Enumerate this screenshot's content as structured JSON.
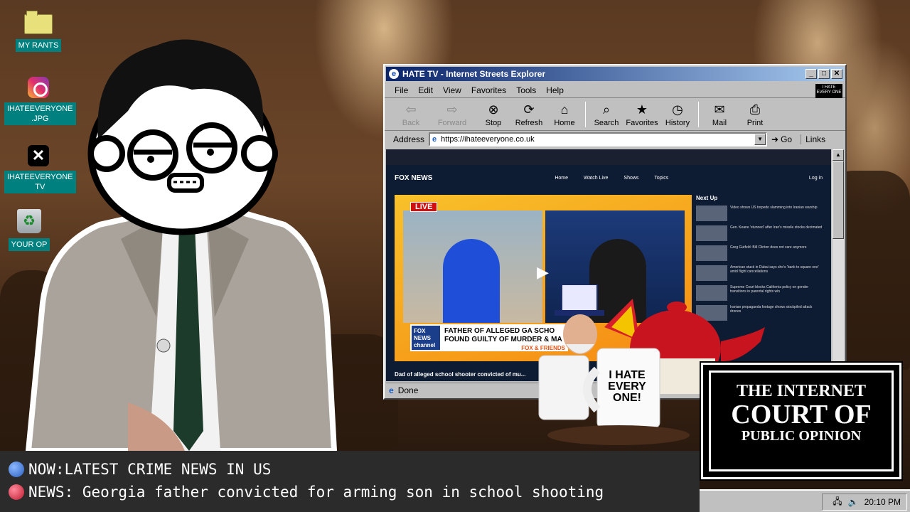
{
  "desktop": {
    "icons": [
      {
        "label": "MY RANTS",
        "icon": "folder-icon"
      },
      {
        "label": "IHATEEVERYONE\n.JPG",
        "icon": "instagram-icon"
      },
      {
        "label": "IHATEEVERYONE\nTV",
        "icon": "x-icon"
      },
      {
        "label": "YOUR OP",
        "icon": "recycle-bin-icon"
      }
    ]
  },
  "browser": {
    "title": "HATE TV - Internet Streets Explorer",
    "menu": [
      "File",
      "Edit",
      "View",
      "Favorites",
      "Tools",
      "Help"
    ],
    "toolbar": {
      "back": "Back",
      "forward": "Forward",
      "stop": "Stop",
      "refresh": "Refresh",
      "home": "Home",
      "search": "Search",
      "favorites": "Favorites",
      "history": "History",
      "mail": "Mail",
      "print": "Print"
    },
    "address_label": "Address",
    "url": "https://ihateeveryone.co.uk",
    "go": "Go",
    "links": "Links",
    "status": "Done",
    "brand_badge": "I HATE EVERY ONE"
  },
  "page": {
    "site_logo": "FOX NEWS",
    "nav": [
      "Home",
      "Watch Live",
      "Shows",
      "Topics"
    ],
    "login": "Log in",
    "live_badge": "LIVE",
    "chyron_logo": "FOX NEWS channel",
    "chyron_line1": "FATHER OF ALLEGED GA SCHO",
    "chyron_line2": "FOUND GUILTY OF MURDER & MA",
    "chyron_show": "FOX & FRIENDS",
    "next_up_label": "Next Up",
    "next_up": [
      "Video shows US torpedo slamming into Iranian warship",
      "Gen. Keane 'stunned' after Iran's missile stocks decimated",
      "Greg Gutfeld: Bill Clinton does not care anymore",
      "American stuck in Dubai says she's 'bank to square one' amid flight cancellations",
      "Supreme Court blocks California policy on gender transitions in parental rights win",
      "Iranian propaganda footage shows stockpiled attack drones"
    ],
    "video_title": "Dad of alleged school shooter convicted of mu..."
  },
  "mug": {
    "text": "I HATE EVERY ONE!"
  },
  "court_sign": {
    "line1": "THE INTERNET",
    "line2": "COURT OF",
    "line3": "PUBLIC OPINION"
  },
  "ticker": {
    "line1": "NOW:LATEST CRIME NEWS IN US",
    "line2": "NEWS: Georgia father convicted for arming son in school shooting",
    "dot1_color": "#3a7bd5",
    "dot2_color": "#d8304a"
  },
  "taskbar": {
    "clock": "20:10 PM"
  }
}
